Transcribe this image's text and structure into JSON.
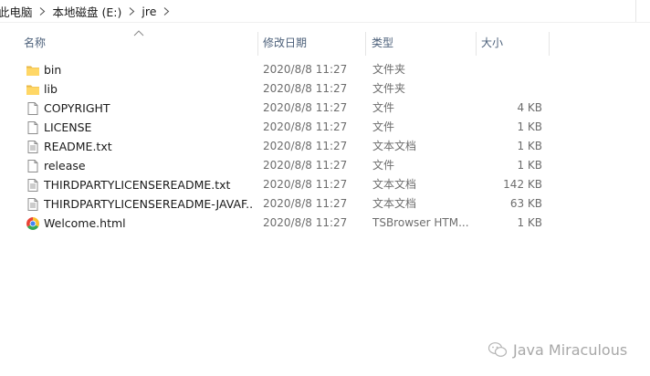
{
  "breadcrumb": {
    "items": [
      "此电脑",
      "本地磁盘 (E:)",
      "jre"
    ]
  },
  "columns": {
    "name": "名称",
    "date": "修改日期",
    "type": "类型",
    "size": "大小"
  },
  "files": [
    {
      "name": "bin",
      "date": "2020/8/8 11:27",
      "type": "文件夹",
      "size": "",
      "icon": "folder-icon"
    },
    {
      "name": "lib",
      "date": "2020/8/8 11:27",
      "type": "文件夹",
      "size": "",
      "icon": "folder-icon"
    },
    {
      "name": "COPYRIGHT",
      "date": "2020/8/8 11:27",
      "type": "文件",
      "size": "4 KB",
      "icon": "file-icon"
    },
    {
      "name": "LICENSE",
      "date": "2020/8/8 11:27",
      "type": "文件",
      "size": "1 KB",
      "icon": "file-icon"
    },
    {
      "name": "README.txt",
      "date": "2020/8/8 11:27",
      "type": "文本文档",
      "size": "1 KB",
      "icon": "text-file-icon"
    },
    {
      "name": "release",
      "date": "2020/8/8 11:27",
      "type": "文件",
      "size": "1 KB",
      "icon": "file-icon"
    },
    {
      "name": "THIRDPARTYLICENSEREADME.txt",
      "date": "2020/8/8 11:27",
      "type": "文本文档",
      "size": "142 KB",
      "icon": "text-file-icon"
    },
    {
      "name": "THIRDPARTYLICENSEREADME-JAVAF...",
      "date": "2020/8/8 11:27",
      "type": "文本文档",
      "size": "63 KB",
      "icon": "text-file-icon"
    },
    {
      "name": "Welcome.html",
      "date": "2020/8/8 11:27",
      "type": "TSBrowser HTM...",
      "size": "1 KB",
      "icon": "chrome-html-icon"
    }
  ],
  "watermark": {
    "text": "Java Miraculous",
    "icon": "wechat-icon"
  },
  "colors": {
    "folder": "#ffd766",
    "header_text": "#4c607a",
    "secondary_text": "#6d6d6d"
  }
}
